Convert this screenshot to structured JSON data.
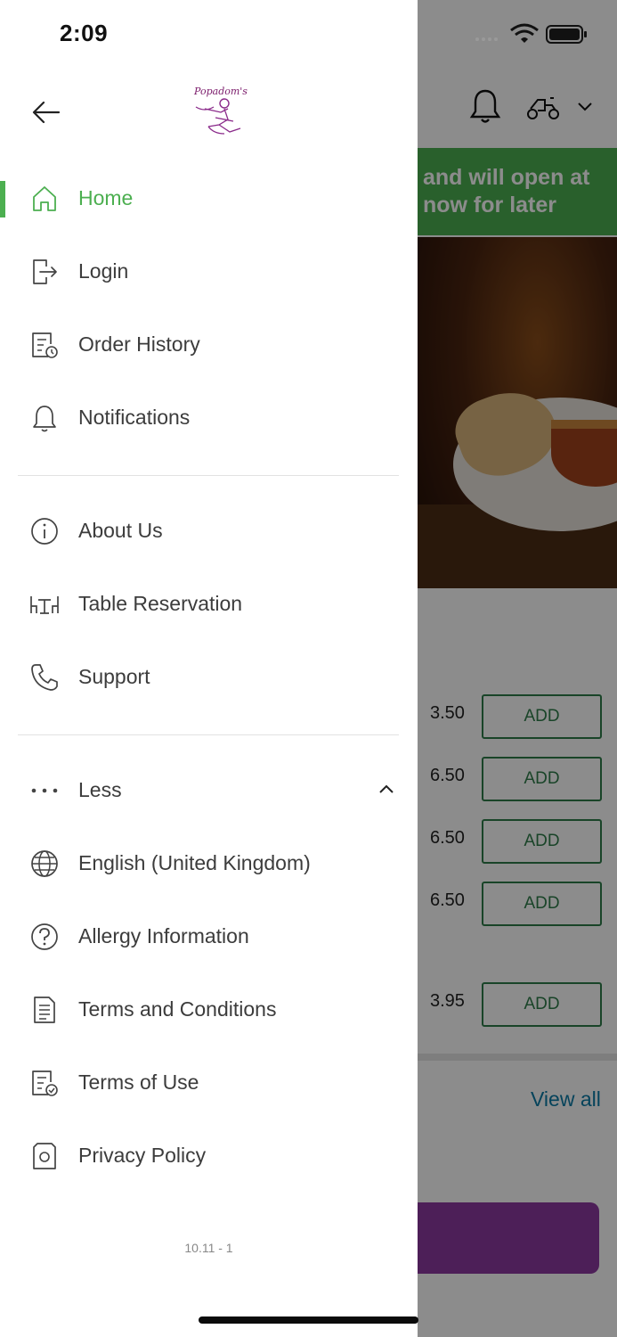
{
  "status_bar": {
    "time": "2:09"
  },
  "background": {
    "banner_lines": [
      "and will open at",
      "now for later"
    ],
    "items": [
      {
        "price": "3.50",
        "button": "ADD"
      },
      {
        "price": "6.50",
        "button": "ADD"
      },
      {
        "price": "6.50",
        "button": "ADD"
      },
      {
        "price": "6.50",
        "button": "ADD"
      },
      {
        "price": "3.95",
        "button": "ADD"
      }
    ],
    "view_all": "View all"
  },
  "drawer": {
    "logo_text": "Popadom's",
    "accent_color": "#4caf50",
    "primary_items": [
      {
        "label": "Home",
        "icon": "home-icon",
        "active": true
      },
      {
        "label": "Login",
        "icon": "login-icon",
        "active": false
      },
      {
        "label": "Order History",
        "icon": "order-history-icon",
        "active": false
      },
      {
        "label": "Notifications",
        "icon": "bell-icon",
        "active": false
      }
    ],
    "secondary_items": [
      {
        "label": "About Us",
        "icon": "info-icon"
      },
      {
        "label": "Table Reservation",
        "icon": "table-icon"
      },
      {
        "label": "Support",
        "icon": "phone-icon"
      }
    ],
    "less_label": "Less",
    "more_items": [
      {
        "label": "English (United Kingdom)",
        "icon": "globe-icon"
      },
      {
        "label": "Allergy Information",
        "icon": "question-icon"
      },
      {
        "label": "Terms and Conditions",
        "icon": "document-icon"
      },
      {
        "label": "Terms of Use",
        "icon": "document-check-icon"
      },
      {
        "label": "Privacy Policy",
        "icon": "privacy-icon"
      }
    ],
    "version": "10.11 - 1"
  }
}
